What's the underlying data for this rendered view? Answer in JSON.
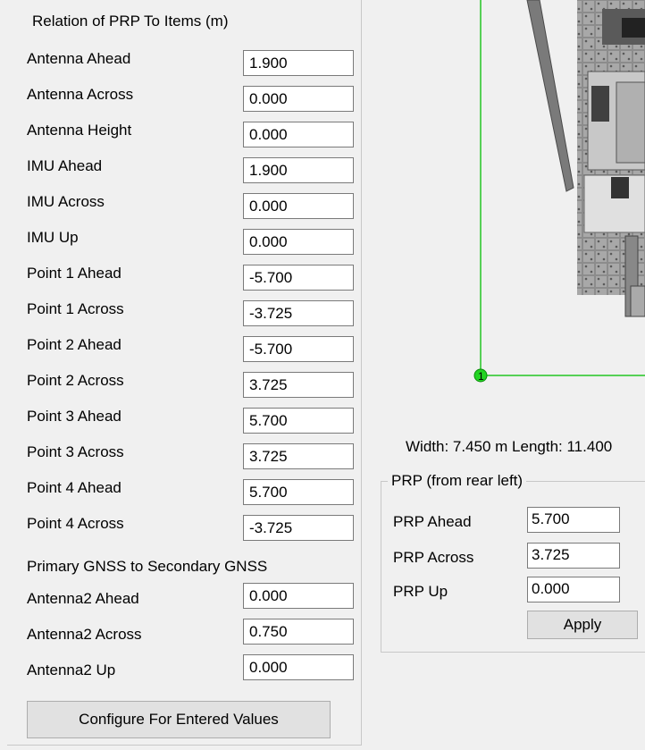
{
  "left": {
    "section_title": "Relation of PRP To Items (m)",
    "fields": [
      {
        "label": "Antenna Ahead",
        "value": "1.900"
      },
      {
        "label": "Antenna Across",
        "value": "0.000"
      },
      {
        "label": "Antenna Height",
        "value": "0.000"
      },
      {
        "label": "IMU Ahead",
        "value": "1.900"
      },
      {
        "label": "IMU Across",
        "value": "0.000"
      },
      {
        "label": "IMU Up",
        "value": "0.000"
      },
      {
        "label": "Point 1 Ahead",
        "value": "-5.700"
      },
      {
        "label": "Point 1 Across",
        "value": "-3.725"
      },
      {
        "label": "Point 2 Ahead",
        "value": "-5.700"
      },
      {
        "label": "Point 2 Across",
        "value": "3.725"
      },
      {
        "label": "Point 3 Ahead",
        "value": "5.700"
      },
      {
        "label": "Point 3 Across",
        "value": "3.725"
      },
      {
        "label": "Point 4 Ahead",
        "value": "5.700"
      },
      {
        "label": "Point 4 Across",
        "value": "-3.725"
      }
    ],
    "gnss_title": "Primary GNSS to Secondary GNSS",
    "gnss_fields": [
      {
        "label": "Antenna2 Ahead",
        "value": "0.000"
      },
      {
        "label": "Antenna2 Across",
        "value": "0.750"
      },
      {
        "label": "Antenna2 Up",
        "value": "0.000"
      }
    ],
    "configure_button": "Configure For Entered Values"
  },
  "viewport": {
    "point_marker": "1",
    "dimensions_text": "Width: 7.450 m Length: 11.400",
    "outline_color": "#22c522"
  },
  "prp": {
    "group_title": "PRP (from rear left)",
    "fields": [
      {
        "label": "PRP Ahead",
        "value": "5.700"
      },
      {
        "label": "PRP Across",
        "value": "3.725"
      },
      {
        "label": "PRP Up",
        "value": "0.000"
      }
    ],
    "apply_button": "Apply"
  }
}
